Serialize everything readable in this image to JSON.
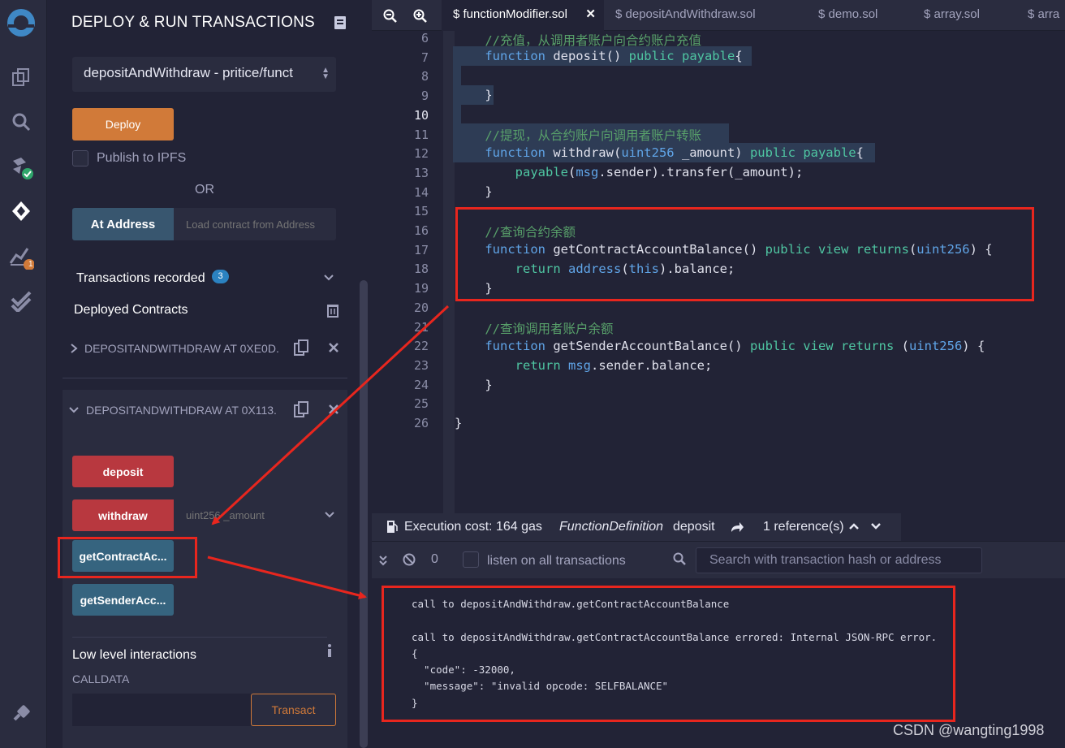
{
  "sidebar": {
    "title": "DEPLOY & RUN TRANSACTIONS",
    "contract_select": "depositAndWithdraw - pritice/funct",
    "deploy_label": "Deploy",
    "publish_ipfs_label": "Publish to IPFS",
    "or_label": "OR",
    "at_address_label": "At Address",
    "load_address_placeholder": "Load contract from Address",
    "transactions_recorded_label": "Transactions recorded",
    "transactions_recorded_count": "3",
    "deployed_contracts_label": "Deployed Contracts",
    "contracts": [
      {
        "name": "DEPOSITANDWITHDRAW AT 0XE0D."
      },
      {
        "name": "DEPOSITANDWITHDRAW AT 0X113."
      }
    ],
    "functions": {
      "deposit": "deposit",
      "withdraw": "withdraw",
      "withdraw_placeholder": "uint256 _amount",
      "get_contract": "getContractAc...",
      "get_sender": "getSenderAcc..."
    },
    "low_level_label": "Low level interactions",
    "calldata_label": "CALLDATA",
    "transact_label": "Transact",
    "plugin_badge": "1"
  },
  "editor": {
    "tabs": [
      {
        "label": "functionModifier.sol",
        "active": true
      },
      {
        "label": "depositAndWithdraw.sol",
        "active": false
      },
      {
        "label": "demo.sol",
        "active": false
      },
      {
        "label": "array.sol",
        "active": false
      },
      {
        "label": "arra",
        "active": false
      }
    ],
    "line_numbers": [
      "6",
      "7",
      "8",
      "9",
      "10",
      "11",
      "12",
      "13",
      "14",
      "15",
      "16",
      "17",
      "18",
      "19",
      "20",
      "21",
      "22",
      "23",
      "24",
      "25",
      "26"
    ],
    "info_bar": {
      "execution_cost": "Execution cost: 164 gas",
      "function_def": "FunctionDefinition",
      "function_name": "deposit",
      "references": "1 reference(s)"
    }
  },
  "terminal": {
    "count": "0",
    "listen_label": "listen on all transactions",
    "search_placeholder": "Search with transaction hash or address",
    "lines": [
      "call to depositAndWithdraw.getContractAccountBalance",
      "call to depositAndWithdraw.getContractAccountBalance errored: Internal JSON-RPC error.",
      "{",
      "  \"code\": -32000,",
      "  \"message\": \"invalid opcode: SELFBALANCE\"",
      "}"
    ]
  },
  "watermark": "CSDN @wangting1998",
  "colors": {
    "deploy": "#d17a39",
    "payable_fn": "#b8383f",
    "view_fn": "#36647f",
    "annotation": "#e8261e"
  }
}
